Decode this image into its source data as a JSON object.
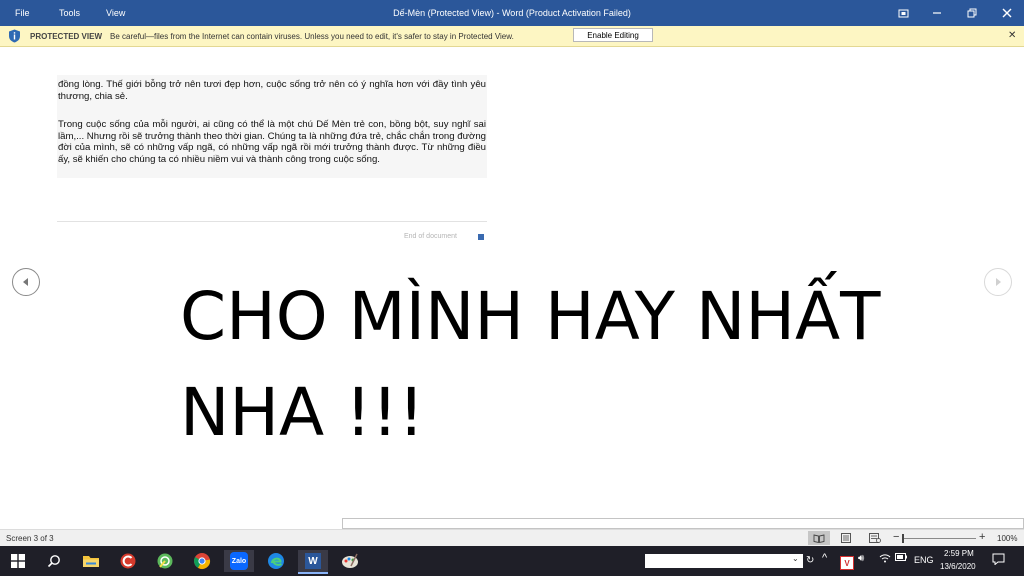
{
  "titlebar": {
    "menu": [
      "File",
      "Tools",
      "View"
    ],
    "title": "Dế-Mèn (Protected View) - Word (Product Activation Failed)",
    "icons": [
      "focus-mode-icon",
      "minimize-icon",
      "restore-icon",
      "close-icon"
    ]
  },
  "protected_bar": {
    "label": "PROTECTED VIEW",
    "message": "Be careful—files from the Internet can contain viruses. Unless you need to edit, it's safer to stay in Protected View.",
    "button": "Enable Editing"
  },
  "document": {
    "paragraph1": "đồng lòng. Thế giới bỗng trở nên tươi đẹp hơn, cuộc sống trở nên có ý nghĩa hơn với đầy tình yêu thương, chia sẻ.",
    "paragraph2": "Trong cuộc sống của mỗi người, ai cũng có thể là một chú Dế Mèn trẻ con, bồng bột, suy nghĩ sai lầm,... Nhưng rồi sẽ trưởng thành theo thời gian. Chúng ta là những đứa trẻ, chắc chắn trong đường đời của mình, sẽ có những vấp ngã, có những vấp ngã rồi mới trưởng thành được. Từ những điều ấy, sẽ khiến cho chúng ta có nhiều niềm vui và thành công trong cuộc sống.",
    "end_marker": "End of document"
  },
  "overlay": {
    "line1": "CHO MÌNH HAY NHẤT",
    "line2": "NHA !!!"
  },
  "statusbar": {
    "screen": "Screen 3 of 3",
    "zoom": "100%"
  },
  "taskbar": {
    "apps": [
      "windows-start-icon",
      "search-icon",
      "file-explorer-icon",
      "ccleaner-icon",
      "app-green-icon",
      "chrome-icon",
      "zalo-icon",
      "edge-icon",
      "word-icon",
      "paint-icon"
    ],
    "zalo_label": "Zalo",
    "word_label": "W",
    "vietkey_label": "V",
    "language": "ENG",
    "time": "2:59 PM",
    "date": "13/6/2020"
  },
  "colors": {
    "titlebar": "#2b579a",
    "protected_bar": "#fdf6c3",
    "taskbar": "#1f1f28"
  }
}
